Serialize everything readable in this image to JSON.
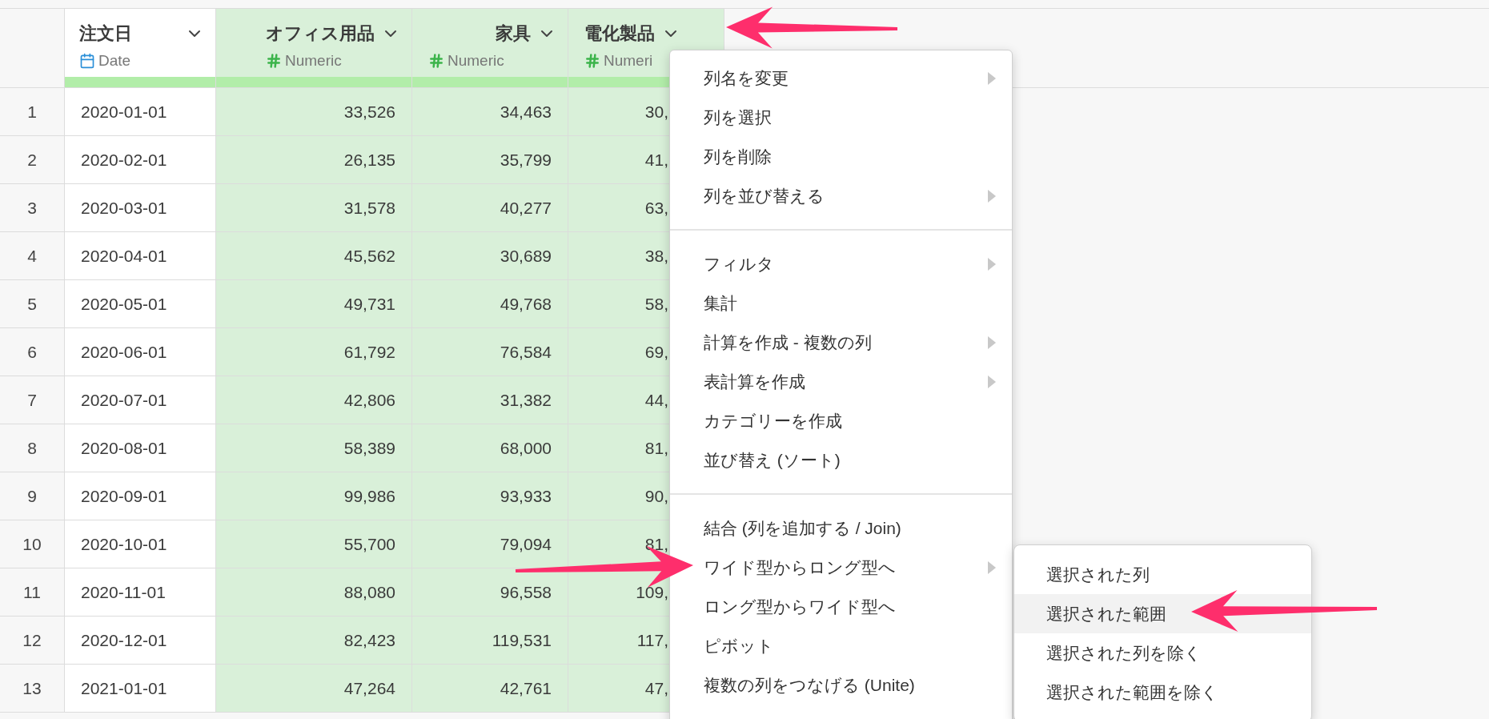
{
  "table": {
    "columns": [
      {
        "name": "注文日",
        "type": "Date",
        "kind": "date",
        "selected": false
      },
      {
        "name": "オフィス用品",
        "type": "Numeric",
        "kind": "numeric",
        "selected": true
      },
      {
        "name": "家具",
        "type": "Numeric",
        "kind": "numeric",
        "selected": true
      },
      {
        "name": "電化製品",
        "type": "Numeri",
        "kind": "numeric",
        "selected": true
      }
    ],
    "rows": [
      {
        "number": "1",
        "cells": [
          "2020-01-01",
          "33,526",
          "34,463",
          "30,"
        ]
      },
      {
        "number": "2",
        "cells": [
          "2020-02-01",
          "26,135",
          "35,799",
          "41,"
        ]
      },
      {
        "number": "3",
        "cells": [
          "2020-03-01",
          "31,578",
          "40,277",
          "63,"
        ]
      },
      {
        "number": "4",
        "cells": [
          "2020-04-01",
          "45,562",
          "30,689",
          "38,"
        ]
      },
      {
        "number": "5",
        "cells": [
          "2020-05-01",
          "49,731",
          "49,768",
          "58,"
        ]
      },
      {
        "number": "6",
        "cells": [
          "2020-06-01",
          "61,792",
          "76,584",
          "69,"
        ]
      },
      {
        "number": "7",
        "cells": [
          "2020-07-01",
          "42,806",
          "31,382",
          "44,"
        ]
      },
      {
        "number": "8",
        "cells": [
          "2020-08-01",
          "58,389",
          "68,000",
          "81,"
        ]
      },
      {
        "number": "9",
        "cells": [
          "2020-09-01",
          "99,986",
          "93,933",
          "90,"
        ]
      },
      {
        "number": "10",
        "cells": [
          "2020-10-01",
          "55,700",
          "79,094",
          "81,"
        ]
      },
      {
        "number": "11",
        "cells": [
          "2020-11-01",
          "88,080",
          "96,558",
          "109,"
        ]
      },
      {
        "number": "12",
        "cells": [
          "2020-12-01",
          "82,423",
          "119,531",
          "117,"
        ]
      },
      {
        "number": "13",
        "cells": [
          "2021-01-01",
          "47,264",
          "42,761",
          "47,"
        ]
      }
    ]
  },
  "context_menu": {
    "groups": [
      [
        {
          "label": "列名を変更",
          "submenu": true
        },
        {
          "label": "列を選択",
          "submenu": false
        },
        {
          "label": "列を削除",
          "submenu": false
        },
        {
          "label": "列を並び替える",
          "submenu": true
        }
      ],
      [
        {
          "label": "フィルタ",
          "submenu": true
        },
        {
          "label": "集計",
          "submenu": false
        },
        {
          "label": "計算を作成 - 複数の列",
          "submenu": true
        },
        {
          "label": "表計算を作成",
          "submenu": true
        },
        {
          "label": "カテゴリーを作成",
          "submenu": false
        },
        {
          "label": "並び替え (ソート)",
          "submenu": false
        }
      ],
      [
        {
          "label": "結合 (列を追加する / Join)",
          "submenu": false
        },
        {
          "label": "ワイド型からロング型へ",
          "submenu": true
        },
        {
          "label": "ロング型からワイド型へ",
          "submenu": false
        },
        {
          "label": "ピボット",
          "submenu": false
        },
        {
          "label": "複数の列をつなげる (Unite)",
          "submenu": false
        }
      ]
    ]
  },
  "submenu": {
    "items": [
      {
        "label": "選択された列",
        "selected": false
      },
      {
        "label": "選択された範囲",
        "selected": true
      },
      {
        "label": "選択された列を除く",
        "selected": false
      },
      {
        "label": "選択された範囲を除く",
        "selected": false
      }
    ]
  }
}
